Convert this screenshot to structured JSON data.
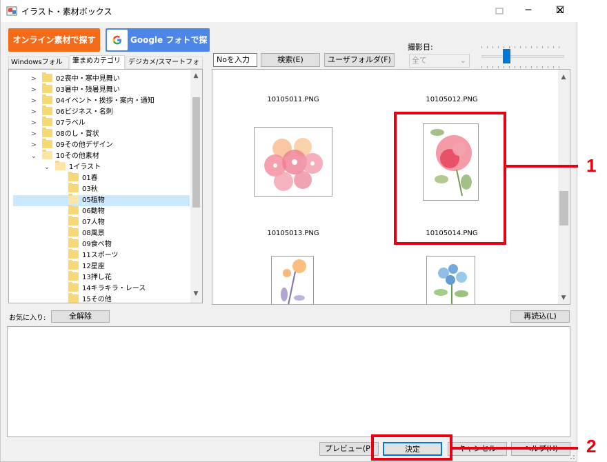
{
  "window": {
    "title": "イラスト・素材ボックス"
  },
  "toolbar": {
    "online_label": "オンライン素材で探す",
    "google_label": "Google フォトで探す",
    "no_input_value": "Noを入力",
    "search_label": "検索(E)",
    "user_folder_label": "ユーザフォルダ(F)",
    "date_label": "撮影日:",
    "date_value": "全て"
  },
  "tabs": [
    {
      "label": "Windowsフォルダ"
    },
    {
      "label": "筆まめカテゴリ"
    },
    {
      "label": "デジカメ/スマートフォン"
    }
  ],
  "tree": [
    "02喪中・寒中見舞い",
    "03暑中・残暑見舞い",
    "04イベント・挨拶・案内・通知",
    "06ビジネス・名刺",
    "07ラベル",
    "08のし・賞状",
    "09その他デザイン",
    "10その他素材",
    "1イラスト",
    "01春",
    "03秋",
    "05植物",
    "06動物",
    "07人物",
    "08風景",
    "09食べ物",
    "11スポーツ",
    "12星座",
    "13押し花",
    "14キラキラ・レース",
    "15その他"
  ],
  "images": [
    {
      "name": "10105011.PNG"
    },
    {
      "name": "10105012.PNG"
    },
    {
      "name": "10105013.PNG"
    },
    {
      "name": "10105014.PNG"
    }
  ],
  "favorites": {
    "label": "お気に入り:",
    "clear_label": "全解除",
    "reload_label": "再読込(L)"
  },
  "footer": {
    "preview_label": "プレビュー(P)",
    "ok_label": "決定",
    "cancel_label": "キャンセル",
    "help_label": "ヘルプ(H)"
  },
  "callouts": {
    "one": "1",
    "two": "2"
  },
  "colors": {
    "accent": "#0078d7",
    "online": "#f46b1a",
    "google": "#4d86e6",
    "highlight": "#e60012"
  }
}
